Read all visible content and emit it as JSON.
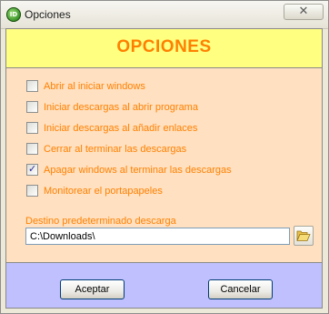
{
  "window": {
    "title": "Opciones",
    "app_icon_text": "ID",
    "close_symbol": "✕"
  },
  "header": {
    "title": "OPCIONES"
  },
  "options": [
    {
      "label": "Abrir al iniciar windows",
      "checked": false
    },
    {
      "label": "Iniciar descargas al abrir programa",
      "checked": false
    },
    {
      "label": "Iniciar descargas al añadir enlaces",
      "checked": false
    },
    {
      "label": "Cerrar al terminar las descargas",
      "checked": false
    },
    {
      "label": "Apagar windows al terminar las descargas",
      "checked": true
    },
    {
      "label": "Monitorear el portapapeles",
      "checked": false
    }
  ],
  "destination": {
    "label": "Destino predeterminado descarga",
    "value": "C:\\Downloads\\",
    "browse_icon": "folder-open-icon"
  },
  "buttons": {
    "accept": "Aceptar",
    "cancel": "Cancelar"
  },
  "colors": {
    "accent_text": "#ff8000",
    "header_bg": "#ffff80",
    "main_bg": "#ffe0c0",
    "footer_bg": "#c0c0ff"
  }
}
